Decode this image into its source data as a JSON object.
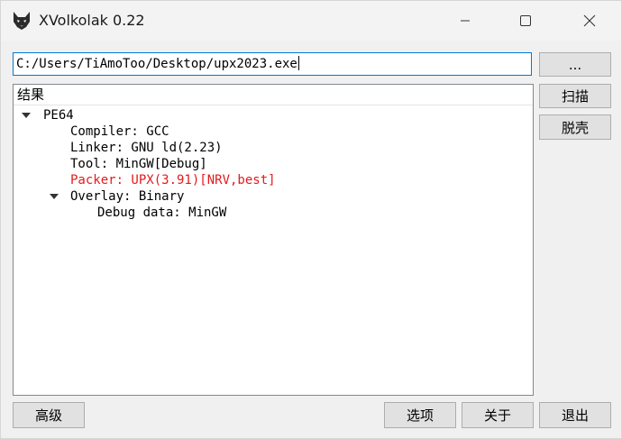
{
  "window": {
    "title": "XVolkolak 0.22"
  },
  "path_input": {
    "value": "C:/Users/TiAmoToo/Desktop/upx2023.exe"
  },
  "buttons": {
    "browse": "...",
    "scan": "扫描",
    "unpack": "脱壳",
    "advanced": "高级",
    "options": "选项",
    "about": "关于",
    "exit": "退出"
  },
  "tree": {
    "header": "结果",
    "root": "PE64",
    "compiler": "Compiler: GCC",
    "linker": "Linker: GNU ld(2.23)",
    "tool": "Tool: MinGW[Debug]",
    "packer": "Packer: UPX(3.91)[NRV,best]",
    "overlay": "Overlay: Binary",
    "debug_data": "Debug data: MinGW"
  },
  "colors": {
    "accent": "#0078d4",
    "packer_highlight": "#e41a1c"
  },
  "icons": {
    "app": "wolf-head-icon",
    "minimize": "minimize-icon",
    "maximize": "maximize-icon",
    "close": "close-icon"
  }
}
